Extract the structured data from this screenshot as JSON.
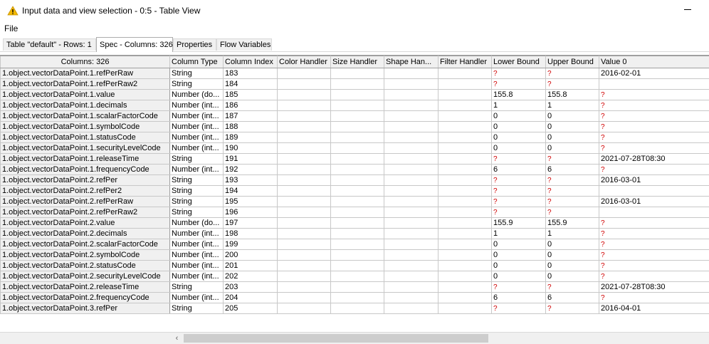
{
  "window": {
    "title": "Input data and view selection - 0:5 - Table View"
  },
  "menu": {
    "file": "File"
  },
  "tabs": [
    {
      "label": "Table \"default\" - Rows: 1",
      "active": false
    },
    {
      "label": "Spec - Columns: 326",
      "active": true
    },
    {
      "label": "Properties",
      "active": false
    },
    {
      "label": "Flow Variables",
      "active": false
    }
  ],
  "table": {
    "headers": [
      "Columns: 326",
      "Column Type",
      "Column Index",
      "Color Handler",
      "Size Handler",
      "Shape Han...",
      "Filter Handler",
      "Lower Bound",
      "Upper Bound",
      "Value 0"
    ],
    "missing_marker": "?",
    "rows": [
      [
        "1.object.vectorDataPoint.1.refPerRaw",
        "String",
        "183",
        "",
        "",
        "",
        "",
        "?",
        "?",
        "2016-02-01"
      ],
      [
        "1.object.vectorDataPoint.1.refPerRaw2",
        "String",
        "184",
        "",
        "",
        "",
        "",
        "?",
        "?",
        ""
      ],
      [
        "1.object.vectorDataPoint.1.value",
        "Number (do...",
        "185",
        "",
        "",
        "",
        "",
        "155.8",
        "155.8",
        "?"
      ],
      [
        "1.object.vectorDataPoint.1.decimals",
        "Number (int...",
        "186",
        "",
        "",
        "",
        "",
        "1",
        "1",
        "?"
      ],
      [
        "1.object.vectorDataPoint.1.scalarFactorCode",
        "Number (int...",
        "187",
        "",
        "",
        "",
        "",
        "0",
        "0",
        "?"
      ],
      [
        "1.object.vectorDataPoint.1.symbolCode",
        "Number (int...",
        "188",
        "",
        "",
        "",
        "",
        "0",
        "0",
        "?"
      ],
      [
        "1.object.vectorDataPoint.1.statusCode",
        "Number (int...",
        "189",
        "",
        "",
        "",
        "",
        "0",
        "0",
        "?"
      ],
      [
        "1.object.vectorDataPoint.1.securityLevelCode",
        "Number (int...",
        "190",
        "",
        "",
        "",
        "",
        "0",
        "0",
        "?"
      ],
      [
        "1.object.vectorDataPoint.1.releaseTime",
        "String",
        "191",
        "",
        "",
        "",
        "",
        "?",
        "?",
        "2021-07-28T08:30"
      ],
      [
        "1.object.vectorDataPoint.1.frequencyCode",
        "Number (int...",
        "192",
        "",
        "",
        "",
        "",
        "6",
        "6",
        "?"
      ],
      [
        "1.object.vectorDataPoint.2.refPer",
        "String",
        "193",
        "",
        "",
        "",
        "",
        "?",
        "?",
        "2016-03-01"
      ],
      [
        "1.object.vectorDataPoint.2.refPer2",
        "String",
        "194",
        "",
        "",
        "",
        "",
        "?",
        "?",
        ""
      ],
      [
        "1.object.vectorDataPoint.2.refPerRaw",
        "String",
        "195",
        "",
        "",
        "",
        "",
        "?",
        "?",
        "2016-03-01"
      ],
      [
        "1.object.vectorDataPoint.2.refPerRaw2",
        "String",
        "196",
        "",
        "",
        "",
        "",
        "?",
        "?",
        ""
      ],
      [
        "1.object.vectorDataPoint.2.value",
        "Number (do...",
        "197",
        "",
        "",
        "",
        "",
        "155.9",
        "155.9",
        "?"
      ],
      [
        "1.object.vectorDataPoint.2.decimals",
        "Number (int...",
        "198",
        "",
        "",
        "",
        "",
        "1",
        "1",
        "?"
      ],
      [
        "1.object.vectorDataPoint.2.scalarFactorCode",
        "Number (int...",
        "199",
        "",
        "",
        "",
        "",
        "0",
        "0",
        "?"
      ],
      [
        "1.object.vectorDataPoint.2.symbolCode",
        "Number (int...",
        "200",
        "",
        "",
        "",
        "",
        "0",
        "0",
        "?"
      ],
      [
        "1.object.vectorDataPoint.2.statusCode",
        "Number (int...",
        "201",
        "",
        "",
        "",
        "",
        "0",
        "0",
        "?"
      ],
      [
        "1.object.vectorDataPoint.2.securityLevelCode",
        "Number (int...",
        "202",
        "",
        "",
        "",
        "",
        "0",
        "0",
        "?"
      ],
      [
        "1.object.vectorDataPoint.2.releaseTime",
        "String",
        "203",
        "",
        "",
        "",
        "",
        "?",
        "?",
        "2021-07-28T08:30"
      ],
      [
        "1.object.vectorDataPoint.2.frequencyCode",
        "Number (int...",
        "204",
        "",
        "",
        "",
        "",
        "6",
        "6",
        "?"
      ],
      [
        "1.object.vectorDataPoint.3.refPer",
        "String",
        "205",
        "",
        "",
        "",
        "",
        "?",
        "?",
        "2016-04-01"
      ]
    ]
  },
  "icons": {
    "title": "warning-triangle-icon",
    "scroll_left": "chevron-left-icon"
  },
  "colors": {
    "missing": "#d00000",
    "warning": "#f2b800"
  }
}
